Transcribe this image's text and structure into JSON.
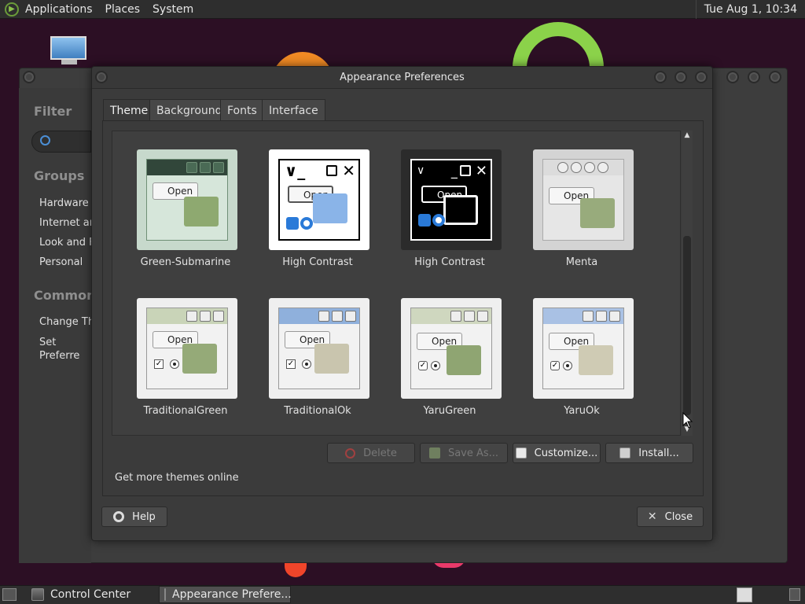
{
  "top_panel": {
    "menus": [
      "Applications",
      "Places",
      "System"
    ],
    "clock": "Tue Aug 1, 10:34"
  },
  "control_center": {
    "filter_label": "Filter",
    "groups_label": "Groups",
    "groups": [
      "Hardware",
      "Internet an",
      "Look and F",
      "Personal"
    ],
    "common_label": "Common T",
    "common_tasks": [
      "Change Th",
      "Set Preferre Application"
    ]
  },
  "dialog": {
    "title": "Appearance Preferences",
    "tabs": [
      "Theme",
      "Background",
      "Fonts",
      "Interface"
    ],
    "active_tab": "Theme",
    "themes": [
      {
        "name": "Green-Submarine"
      },
      {
        "name": "High Contrast"
      },
      {
        "name": "High Contrast",
        "selected": true
      },
      {
        "name": "Menta"
      },
      {
        "name": "TraditionalGreen"
      },
      {
        "name": "TraditionalOk"
      },
      {
        "name": "YaruGreen"
      },
      {
        "name": "YaruOk"
      }
    ],
    "thumb_open_label": "Open",
    "buttons": {
      "delete": "Delete",
      "save_as": "Save As...",
      "customize": "Customize...",
      "install": "Install..."
    },
    "more_themes_link": "Get more themes online",
    "help": "Help",
    "close": "Close"
  },
  "taskbar": {
    "tasks": [
      "Control Center",
      "Appearance Prefere..."
    ],
    "active_task": "Appearance Prefere..."
  },
  "colors": {
    "panel_bg": "#2e2e2e",
    "dialog_bg": "#3b3b3b",
    "desktop_bg": "#2c0f24",
    "accent_blue": "#2a7ad8"
  }
}
